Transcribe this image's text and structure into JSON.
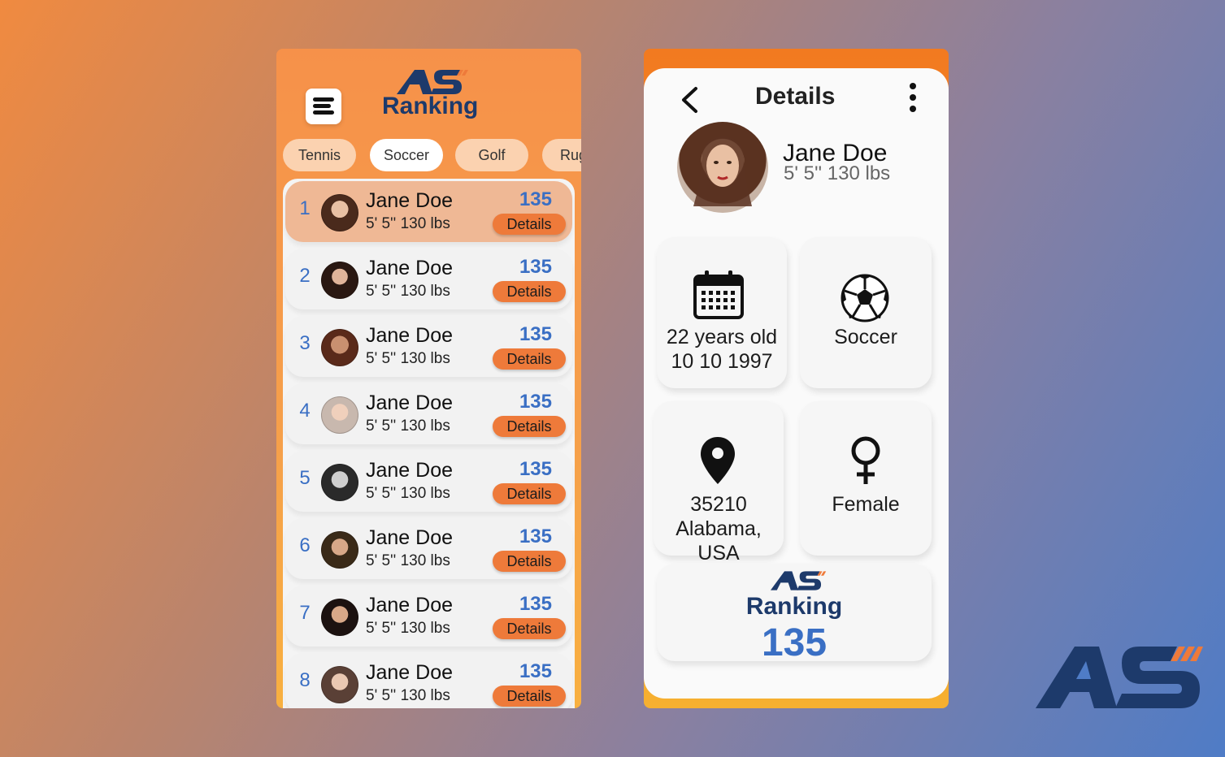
{
  "brand": {
    "logo_text": "AS",
    "product": "Ranking"
  },
  "tabs": [
    "Tennis",
    "Soccer",
    "Golf",
    "Rug"
  ],
  "active_tab": "Soccer",
  "list": [
    {
      "rank": "1",
      "name": "Jane Doe",
      "stats": "5' 5'' 130 lbs",
      "score": "135",
      "button": "Details"
    },
    {
      "rank": "2",
      "name": "Jane Doe",
      "stats": "5' 5'' 130 lbs",
      "score": "135",
      "button": "Details"
    },
    {
      "rank": "3",
      "name": "Jane Doe",
      "stats": "5' 5'' 130 lbs",
      "score": "135",
      "button": "Details"
    },
    {
      "rank": "4",
      "name": "Jane Doe",
      "stats": "5' 5'' 130 lbs",
      "score": "135",
      "button": "Details"
    },
    {
      "rank": "5",
      "name": "Jane Doe",
      "stats": "5' 5'' 130 lbs",
      "score": "135",
      "button": "Details"
    },
    {
      "rank": "6",
      "name": "Jane Doe",
      "stats": "5' 5'' 130 lbs",
      "score": "135",
      "button": "Details"
    },
    {
      "rank": "7",
      "name": "Jane Doe",
      "stats": "5' 5'' 130 lbs",
      "score": "135",
      "button": "Details"
    },
    {
      "rank": "8",
      "name": "Jane Doe",
      "stats": "5' 5'' 130 lbs",
      "score": "135",
      "button": "Details"
    }
  ],
  "details": {
    "title": "Details",
    "name": "Jane Doe",
    "stats": "5' 5'' 130 lbs",
    "age": "22 years old",
    "dob": "10 10 1997",
    "sport": "Soccer",
    "zip": "35210",
    "location": "Alabama, USA",
    "gender": "Female",
    "ranking_label": "Ranking",
    "ranking_value": "135"
  },
  "colors": {
    "accent_orange": "#ee7a3a",
    "brand_navy": "#1d3a6b",
    "score_blue": "#3a6fc4",
    "highlight_row": "#efb895"
  },
  "icons": [
    "menu-icon",
    "back-arrow-icon",
    "more-vertical-icon",
    "calendar-icon",
    "soccer-ball-icon",
    "location-pin-icon",
    "female-icon"
  ]
}
